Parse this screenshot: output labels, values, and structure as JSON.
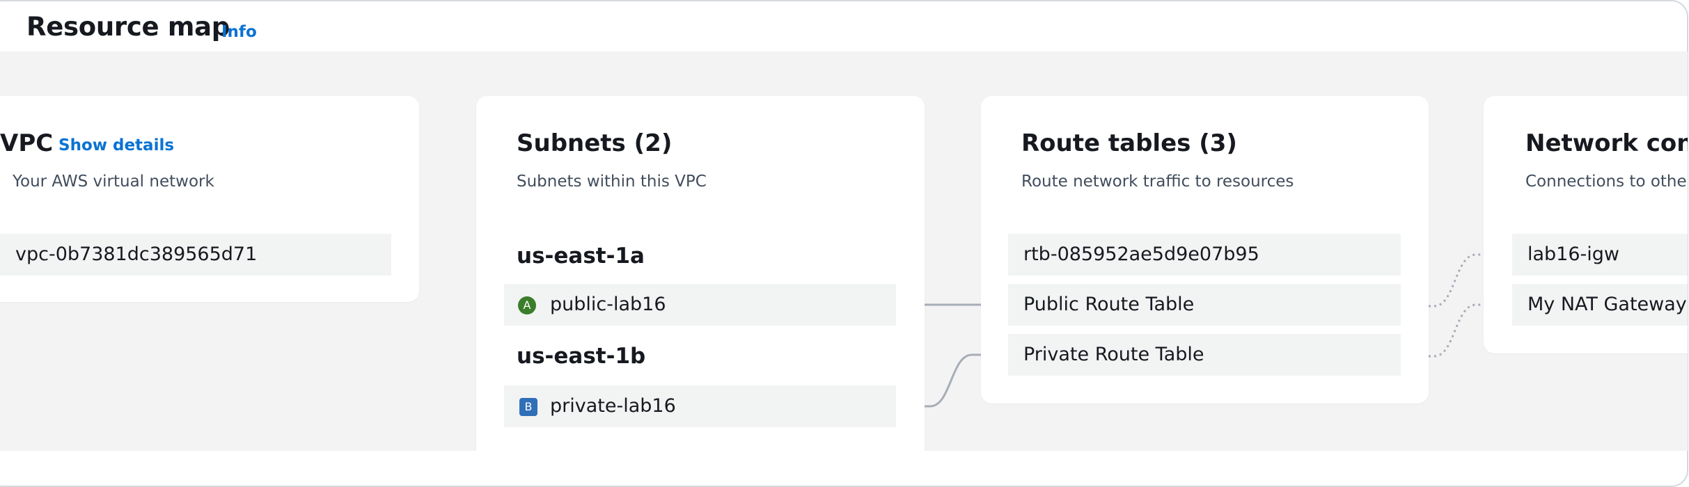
{
  "header": {
    "title": "Resource map",
    "info_link": "Info"
  },
  "vpc": {
    "title": "VPC",
    "details_link": "Show details",
    "subtitle": "Your AWS virtual network",
    "id": "vpc-0b7381dc389565d71"
  },
  "subnets": {
    "title": "Subnets (2)",
    "subtitle": "Subnets within this VPC",
    "zones": [
      {
        "name": "us-east-1a",
        "subnet": {
          "badge": "A",
          "name": "public-lab16"
        }
      },
      {
        "name": "us-east-1b",
        "subnet": {
          "badge": "B",
          "name": "private-lab16"
        }
      }
    ]
  },
  "route_tables": {
    "title": "Route tables (3)",
    "subtitle": "Route network traffic to resources",
    "items": [
      "rtb-085952ae5d9e07b95",
      "Public Route Table",
      "Private Route Table"
    ]
  },
  "network_connections": {
    "title": "Network conn",
    "subtitle": "Connections to other",
    "items": [
      "lab16-igw",
      "My NAT Gateway"
    ]
  },
  "colors": {
    "link": "#0972d3",
    "badge_a": "#3a7d2a",
    "badge_b": "#2f6fb7",
    "canvas": "#f3f3f4",
    "item_bg": "#f2f3f3",
    "connector": "#a7adb6"
  }
}
